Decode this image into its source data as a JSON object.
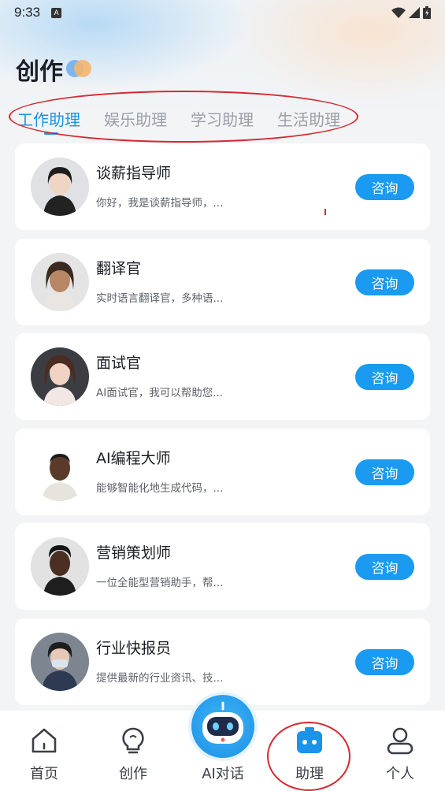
{
  "status_bar": {
    "time": "9:33",
    "badge": "A",
    "icons": [
      "wifi-icon",
      "signal-icon",
      "battery-icon"
    ]
  },
  "header": {
    "title": "创作"
  },
  "tabs": [
    {
      "label": "工作助理",
      "active": true
    },
    {
      "label": "娱乐助理",
      "active": false
    },
    {
      "label": "学习助理",
      "active": false
    },
    {
      "label": "生活助理",
      "active": false
    }
  ],
  "assistants": [
    {
      "name": "谈薪指导师",
      "desc": "你好，我是谈薪指导师，...",
      "button": "咨询"
    },
    {
      "name": "翻译官",
      "desc": "实时语言翻译官，多种语...",
      "button": "咨询"
    },
    {
      "name": "面试官",
      "desc": "AI面试官，我可以帮助您...",
      "button": "咨询"
    },
    {
      "name": "AI编程大师",
      "desc": "能够智能化地生成代码，...",
      "button": "咨询"
    },
    {
      "name": "营销策划师",
      "desc": "一位全能型营销助手，帮...",
      "button": "咨询"
    },
    {
      "name": "行业快报员",
      "desc": "提供最新的行业资讯、技...",
      "button": "咨询"
    }
  ],
  "bottom_nav": [
    {
      "label": "首页",
      "icon": "home-icon"
    },
    {
      "label": "创作",
      "icon": "lightbulb-icon"
    },
    {
      "label": "AI对话",
      "icon": "robot-icon"
    },
    {
      "label": "助理",
      "icon": "assistant-icon",
      "active": true
    },
    {
      "label": "个人",
      "icon": "user-icon"
    }
  ],
  "colors": {
    "accent": "#1a93e8",
    "button": "#1a9af0",
    "annotation": "#d9272f"
  }
}
